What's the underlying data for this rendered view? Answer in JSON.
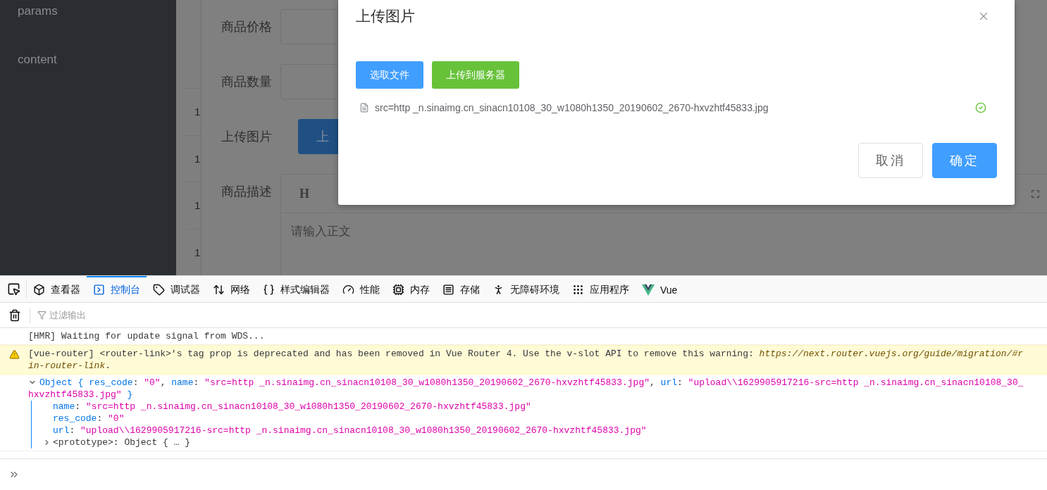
{
  "sidebar": {
    "items": [
      {
        "label": "params"
      },
      {
        "label": "content"
      }
    ]
  },
  "table": {
    "cells": [
      "1",
      "1",
      "1",
      "1"
    ]
  },
  "form": {
    "fields": [
      {
        "label": "商品价格",
        "kind": "input"
      },
      {
        "label": "商品数量",
        "kind": "input"
      },
      {
        "label": "上传图片",
        "kind": "button",
        "button": "上"
      },
      {
        "label": "商品描述",
        "kind": "editor",
        "toolbar": [
          "H"
        ],
        "placeholder": "请输入正文"
      }
    ]
  },
  "dialog": {
    "title": "上传图片",
    "actions": [
      {
        "label": "选取文件",
        "kind": "primary"
      },
      {
        "label": "上传到服务器",
        "kind": "success"
      }
    ],
    "files": [
      {
        "name": "src=http _n.sinaimg.cn_sinacn10108_30_w1080h1350_20190602_2670-hxvzhtf45833.jpg",
        "uploaded": true
      }
    ],
    "footer": [
      {
        "label": "取消",
        "kind": "default"
      },
      {
        "label": "确定",
        "kind": "primary"
      }
    ]
  },
  "devtools": {
    "tabs": [
      {
        "label": "查看器",
        "selected": false
      },
      {
        "label": "控制台",
        "selected": true
      },
      {
        "label": "调试器",
        "selected": false
      },
      {
        "label": "网络",
        "selected": false
      },
      {
        "label": "样式编辑器",
        "selected": false
      },
      {
        "label": "性能",
        "selected": false
      },
      {
        "label": "内存",
        "selected": false
      },
      {
        "label": "存储",
        "selected": false
      },
      {
        "label": "无障碍环境",
        "selected": false
      },
      {
        "label": "应用程序",
        "selected": false
      },
      {
        "label": "Vue",
        "selected": false
      }
    ],
    "filter": {
      "placeholder": "过滤输出"
    },
    "console": [
      {
        "kind": "log",
        "lines": [
          [
            {
              "kind": "plain",
              "text": "[HMR] Waiting for update signal from WDS..."
            }
          ]
        ]
      },
      {
        "kind": "warning",
        "lines": [
          [
            {
              "kind": "plain",
              "text": "[vue-router] <router-link>'s tag prop is deprecated and has been removed in Vue Router 4. Use the v-slot API to remove this warning: "
            },
            {
              "kind": "link",
              "text": "https://next.router.vuejs.org/guide/migration/#r"
            }
          ],
          [
            {
              "kind": "link",
              "text": "in-router-link"
            },
            {
              "kind": "plain",
              "text": "."
            }
          ]
        ]
      },
      {
        "kind": "object",
        "expanded": true,
        "lines": [
          [
            {
              "kind": "key",
              "text": "Object { res_code"
            },
            {
              "kind": "plain",
              "text": ": "
            },
            {
              "kind": "string",
              "text": "\"0\""
            },
            {
              "kind": "plain",
              "text": ", "
            },
            {
              "kind": "key",
              "text": "name"
            },
            {
              "kind": "plain",
              "text": ": "
            },
            {
              "kind": "string",
              "text": "\"src=http _n.sinaimg.cn_sinacn10108_30_w1080h1350_20190602_2670-hxvzhtf45833.jpg\""
            },
            {
              "kind": "plain",
              "text": ", "
            },
            {
              "kind": "key",
              "text": "url"
            },
            {
              "kind": "plain",
              "text": ": "
            },
            {
              "kind": "string",
              "text": "\"upload\\\\1629905917216-src=http _n.sinaimg.cn_sinacn10108_30_"
            }
          ],
          [
            {
              "kind": "string",
              "text": "hxvzhtf45833.jpg\""
            },
            {
              "kind": "key",
              "text": " }"
            }
          ]
        ],
        "properties": [
          [
            {
              "kind": "key",
              "text": "name"
            },
            {
              "kind": "plain",
              "text": ": "
            },
            {
              "kind": "string",
              "text": "\"src=http _n.sinaimg.cn_sinacn10108_30_w1080h1350_20190602_2670-hxvzhtf45833.jpg\""
            }
          ],
          [
            {
              "kind": "key",
              "text": "res_code"
            },
            {
              "kind": "plain",
              "text": ": "
            },
            {
              "kind": "string",
              "text": "\"0\""
            }
          ],
          [
            {
              "kind": "key",
              "text": "url"
            },
            {
              "kind": "plain",
              "text": ": "
            },
            {
              "kind": "string",
              "text": "\"upload\\\\1629905917216-src=http _n.sinaimg.cn_sinacn10108_30_w1080h1350_20190602_2670-hxvzhtf45833.jpg\""
            }
          ]
        ],
        "prototype": {
          "text": "<prototype>: Object { … }",
          "expanded": false
        }
      }
    ]
  }
}
